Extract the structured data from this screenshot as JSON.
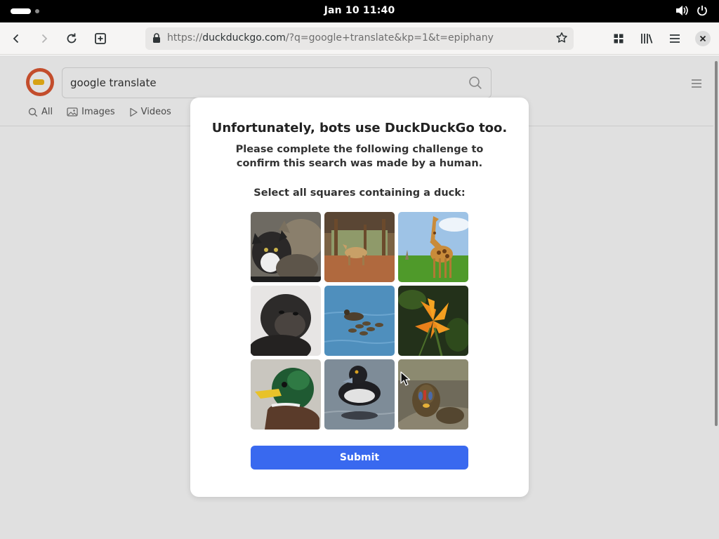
{
  "system": {
    "clock": "Jan 10  11:40",
    "tray_icons": [
      "volume-icon",
      "power-icon"
    ]
  },
  "browser": {
    "url_prefix": "https://",
    "url_host": "duckduckgo.com",
    "url_path": "/?q=google+translate&kp=1&t=epiphany"
  },
  "ddg": {
    "search_query": "google translate",
    "tabs": [
      "All",
      "Images",
      "Videos"
    ]
  },
  "challenge": {
    "title": "Unfortunately, bots use DuckDuckGo too.",
    "subtitle": "Please complete the following challenge to confirm this search was made by a human.",
    "instruction": "Select all squares containing a duck:",
    "tiles": [
      "cats",
      "deer-in-enclosure",
      "giraffe",
      "chimpanzee",
      "ducks-swimming",
      "orange-lily",
      "mallard-duck",
      "diving-duck",
      "mandrill"
    ],
    "submit_label": "Submit"
  },
  "colors": {
    "accent": "#3969ef",
    "brand": "#de5833"
  }
}
